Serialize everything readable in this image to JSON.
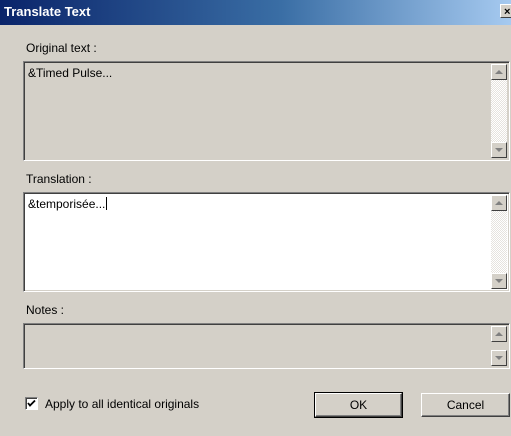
{
  "window": {
    "title": "Translate Text",
    "close_glyph": "×"
  },
  "original": {
    "label": "Original text :",
    "value": "&Timed Pulse..."
  },
  "translation": {
    "label": "Translation :",
    "value": "&temporisée..."
  },
  "notes": {
    "label": "Notes :",
    "value": ""
  },
  "apply_all": {
    "label": "Apply to all identical originals",
    "checked": true
  },
  "buttons": {
    "ok": "OK",
    "cancel": "Cancel"
  },
  "colors": {
    "title_start": "#0a246a",
    "title_end": "#a6caf0",
    "face": "#d4d0c8"
  }
}
